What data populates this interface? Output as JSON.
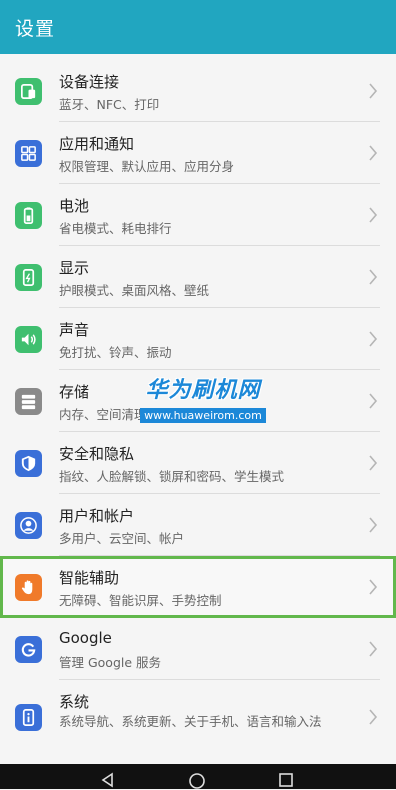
{
  "header": {
    "title": "设置"
  },
  "items": [
    {
      "label": "设备连接",
      "sub": "蓝牙、NFC、打印",
      "icon": "device-connection-icon",
      "color": "#3fbf6f"
    },
    {
      "label": "应用和通知",
      "sub": "权限管理、默认应用、应用分身",
      "icon": "apps-grid-icon",
      "color": "#3a6fd8"
    },
    {
      "label": "电池",
      "sub": "省电模式、耗电排行",
      "icon": "battery-icon",
      "color": "#3fbf6f"
    },
    {
      "label": "显示",
      "sub": "护眼模式、桌面风格、壁纸",
      "icon": "display-icon",
      "color": "#3fbf6f"
    },
    {
      "label": "声音",
      "sub": "免打扰、铃声、振动",
      "icon": "speaker-icon",
      "color": "#3fbf6f"
    },
    {
      "label": "存储",
      "sub": "内存、空间清理",
      "icon": "storage-icon",
      "color": "#8a8a8a"
    },
    {
      "label": "安全和隐私",
      "sub": "指纹、人脸解锁、锁屏和密码、学生模式",
      "icon": "shield-icon",
      "color": "#3a6fd8"
    },
    {
      "label": "用户和帐户",
      "sub": "多用户、云空间、帐户",
      "icon": "user-icon",
      "color": "#3a6fd8"
    },
    {
      "label": "智能辅助",
      "sub": "无障碍、智能识屏、手势控制",
      "icon": "hand-icon",
      "color": "#f07a2a"
    },
    {
      "label": "Google",
      "sub": "管理 Google 服务",
      "icon": "google-icon",
      "color": "#3a6fd8"
    },
    {
      "label": "系统",
      "sub": "系统导航、系统更新、关于手机、语言和输入法",
      "icon": "system-info-icon",
      "color": "#3a6fd8"
    }
  ],
  "watermark": {
    "cn": "华为刷机网",
    "url": "www.huaweirom.com"
  },
  "navbar": {
    "icons": [
      "back-icon",
      "home-icon",
      "recents-icon"
    ]
  }
}
